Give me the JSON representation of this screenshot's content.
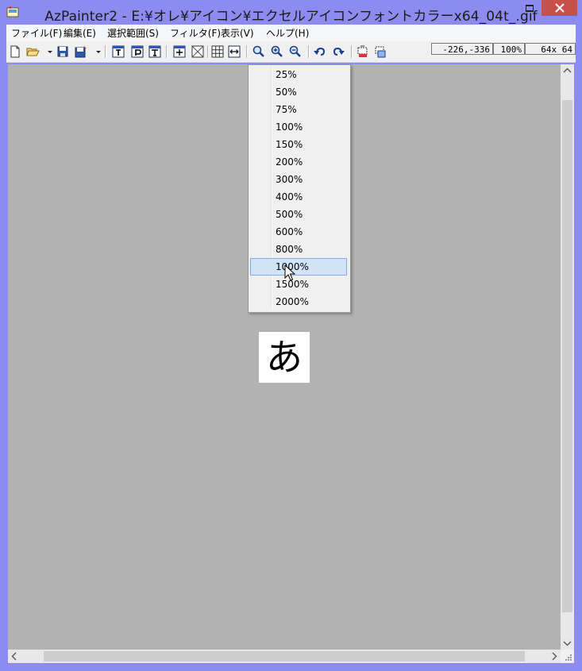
{
  "window": {
    "title": "AzPainter2 - E:¥オレ¥アイコン¥エクセルアイコンフォントカラーx64_04t_.gif",
    "minimize_glyph": "▁",
    "maximize_glyph": "☐",
    "close_glyph": "✕"
  },
  "menu": {
    "items": [
      "ファイル(F)",
      "編集(E)",
      "選択範囲(S)",
      "フィルタ(F)",
      "表示(V)",
      "ヘルプ(H)"
    ]
  },
  "status": {
    "coords": "-226,-336",
    "zoom": "100%",
    "size": "64x  64"
  },
  "zoom_menu": {
    "items": [
      "25%",
      "50%",
      "75%",
      "100%",
      "150%",
      "200%",
      "300%",
      "400%",
      "500%",
      "600%",
      "800%",
      "1000%",
      "1500%",
      "2000%"
    ],
    "selected": "1000%"
  },
  "image": {
    "glyph": "あ"
  },
  "colors": {
    "frame": "#8c8cf0",
    "close_button": "#c7504b",
    "canvas": "#b2b2b2",
    "selection": "#d1e3f6"
  },
  "icons": [
    "new-file-icon",
    "open-folder-icon",
    "dropdown-arrow-icon",
    "save-icon",
    "save-as-icon",
    "text-tool-icon",
    "paste-tool-icon",
    "text-insert-icon",
    "crop-icon",
    "transparent-icon",
    "grid-icon",
    "fit-width-icon",
    "zoom-icon",
    "zoom-in-icon",
    "zoom-out-icon",
    "undo-icon",
    "redo-icon",
    "layer-icon",
    "layer-copy-icon"
  ]
}
